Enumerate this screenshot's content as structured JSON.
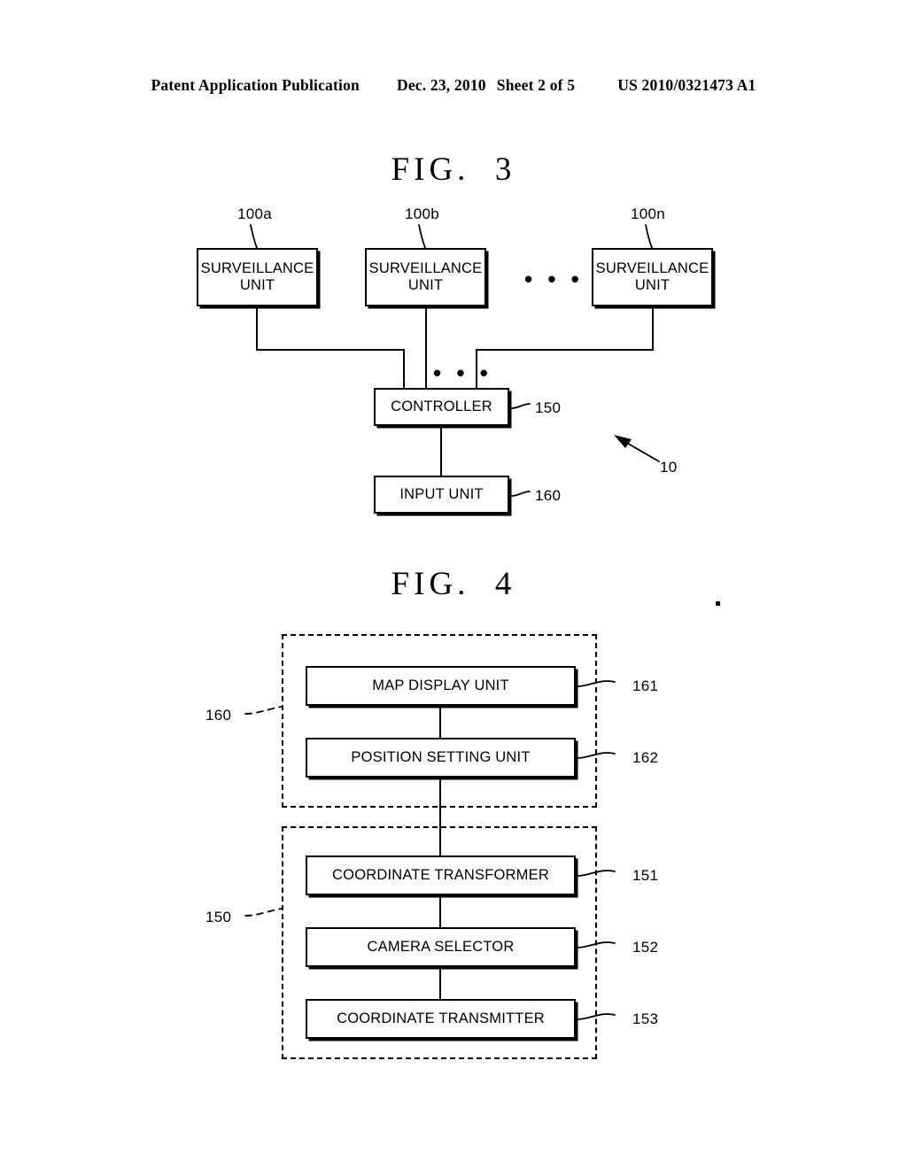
{
  "header": {
    "publication": "Patent Application Publication",
    "date": "Dec. 23, 2010",
    "sheet": "Sheet 2 of 5",
    "patent_number": "US 2010/0321473 A1"
  },
  "figures": [
    {
      "title": "FIG.  3",
      "system_ref": "10",
      "nodes": [
        {
          "id": "100a",
          "label_line1": "SURVEILLANCE",
          "label_line2": "UNIT",
          "ref": "100a"
        },
        {
          "id": "100b",
          "label_line1": "SURVEILLANCE",
          "label_line2": "UNIT",
          "ref": "100b"
        },
        {
          "id": "100n",
          "label_line1": "SURVEILLANCE",
          "label_line2": "UNIT",
          "ref": "100n"
        },
        {
          "id": "150",
          "label_line1": "CONTROLLER",
          "ref": "150"
        },
        {
          "id": "160",
          "label_line1": "INPUT UNIT",
          "ref": "160"
        }
      ],
      "ellipsis": "• • •"
    },
    {
      "title": "FIG.  4",
      "groups": [
        {
          "ref": "160",
          "blocks": [
            {
              "label": "MAP DISPLAY UNIT",
              "ref": "161"
            },
            {
              "label": "POSITION SETTING UNIT",
              "ref": "162"
            }
          ]
        },
        {
          "ref": "150",
          "blocks": [
            {
              "label": "COORDINATE TRANSFORMER",
              "ref": "151"
            },
            {
              "label": "CAMERA SELECTOR",
              "ref": "152"
            },
            {
              "label": "COORDINATE TRANSMITTER",
              "ref": "153"
            }
          ]
        }
      ]
    }
  ],
  "colors": {
    "ink": "#000000",
    "paper": "#ffffff"
  }
}
